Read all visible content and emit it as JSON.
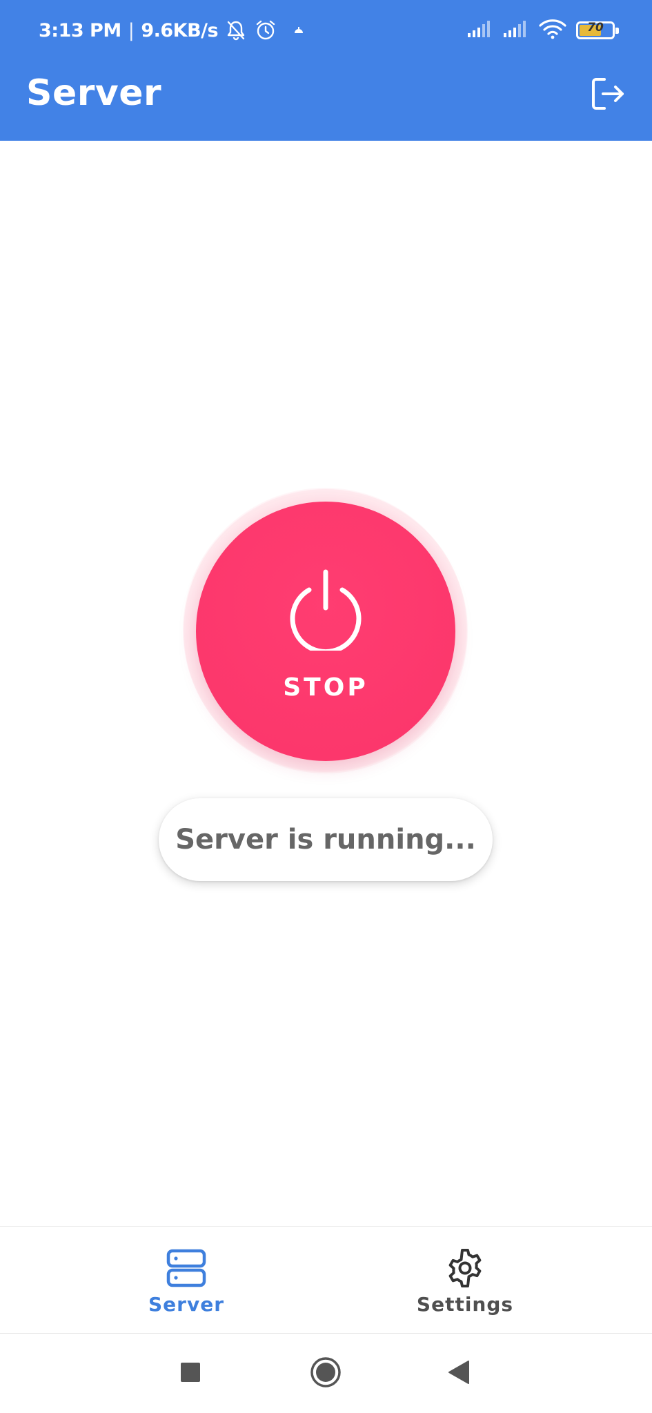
{
  "status_bar": {
    "time": "3:13 PM",
    "separator": "|",
    "network_speed": "9.6KB/s",
    "battery_percent": "70",
    "battery_level": 0.7,
    "icons": [
      "bell-muted-icon",
      "alarm-icon",
      "notification-icon",
      "signal-icon",
      "signal-icon-2",
      "wifi-icon",
      "battery-icon"
    ]
  },
  "app_bar": {
    "title": "Server",
    "action_icon": "logout-icon"
  },
  "power_button": {
    "label": "STOP",
    "icon": "power-icon"
  },
  "status_message": "Server is running...",
  "bottom_nav": {
    "items": [
      {
        "label": "Server",
        "icon": "server-icon",
        "active": true
      },
      {
        "label": "Settings",
        "icon": "gear-icon",
        "active": false
      }
    ]
  },
  "system_nav": {
    "buttons": [
      "recents-button",
      "home-button",
      "back-button"
    ]
  },
  "colors": {
    "app_bar": "#4282E6",
    "power_button": "#FF3D71",
    "active_nav": "#3E7FDD",
    "inactive_nav": "#4F4F4F",
    "status_text": "#666666"
  }
}
